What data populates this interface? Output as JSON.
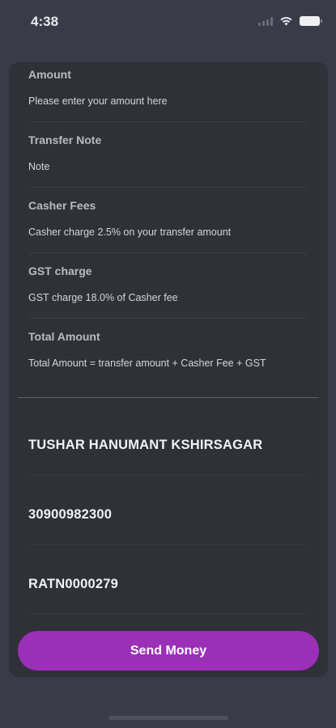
{
  "status_bar": {
    "time": "4:38",
    "icons": [
      "cellular-signal-icon",
      "wifi-icon",
      "battery-icon"
    ]
  },
  "form": {
    "fields": [
      {
        "label": "Amount",
        "hint": "Please enter your amount here"
      },
      {
        "label": "Transfer Note",
        "hint": "Note"
      },
      {
        "label": "Casher Fees",
        "hint": "Casher charge 2.5% on your transfer amount"
      },
      {
        "label": "GST charge",
        "hint": "GST charge 18.0% of Casher fee"
      },
      {
        "label": "Total Amount",
        "hint": "Total Amount =  transfer amount + Casher Fee + GST"
      }
    ]
  },
  "beneficiary": {
    "name": "TUSHAR HANUMANT KSHIRSAGAR",
    "account_number": "30900982300",
    "ifsc": "RATN0000279"
  },
  "actions": {
    "send_label": "Send Money"
  },
  "colors": {
    "background": "#3a3b48",
    "card": "#2f3038",
    "accent": "#9b2fb8"
  }
}
